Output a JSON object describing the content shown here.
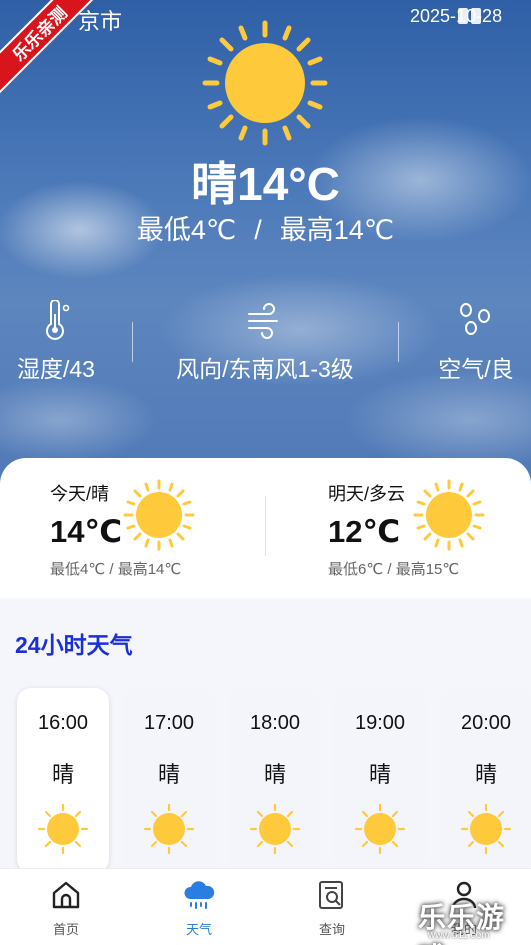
{
  "status_bar": {
    "city": "京市",
    "date": "2025-10-28"
  },
  "badge": {
    "text": "乐乐亲测"
  },
  "current": {
    "condition_temp": "晴14°C",
    "min_label": "最低4℃",
    "separator": "/",
    "max_label": "最高14℃",
    "icon": "sun-icon"
  },
  "stats": [
    {
      "label": "湿度/43",
      "icon": "thermometer-icon"
    },
    {
      "label": "风向/东南风1-3级",
      "icon": "wind-icon"
    },
    {
      "label": "空气/良",
      "icon": "air-quality-icon"
    }
  ],
  "days": [
    {
      "label": "今天/晴",
      "temp": "14℃",
      "range": "最低4℃ / 最高14℃",
      "icon": "sun-icon"
    },
    {
      "label": "明天/多云",
      "temp": "12℃",
      "range": "最低6℃ / 最高15℃",
      "icon": "sun-icon"
    }
  ],
  "hourly_title": "24小时天气",
  "hourly": [
    {
      "time": "16:00",
      "condition": "晴",
      "icon": "sun-icon"
    },
    {
      "time": "17:00",
      "condition": "晴",
      "icon": "sun-icon"
    },
    {
      "time": "18:00",
      "condition": "晴",
      "icon": "sun-icon"
    },
    {
      "time": "19:00",
      "condition": "晴",
      "icon": "sun-icon"
    },
    {
      "time": "20:00",
      "condition": "晴",
      "icon": "sun-icon"
    }
  ],
  "nav": [
    {
      "label": "首页",
      "icon": "home-icon"
    },
    {
      "label": "天气",
      "icon": "weather-icon"
    },
    {
      "label": "查询",
      "icon": "search-doc-icon"
    },
    {
      "label": "我的",
      "icon": "user-icon"
    }
  ],
  "watermark": {
    "text": "乐乐游戏",
    "sub": "www.611.com"
  },
  "colors": {
    "accent": "#2a7de1",
    "section_title": "#1b2fd6",
    "sun": "#ffc93c",
    "badge": "#d8141c"
  }
}
